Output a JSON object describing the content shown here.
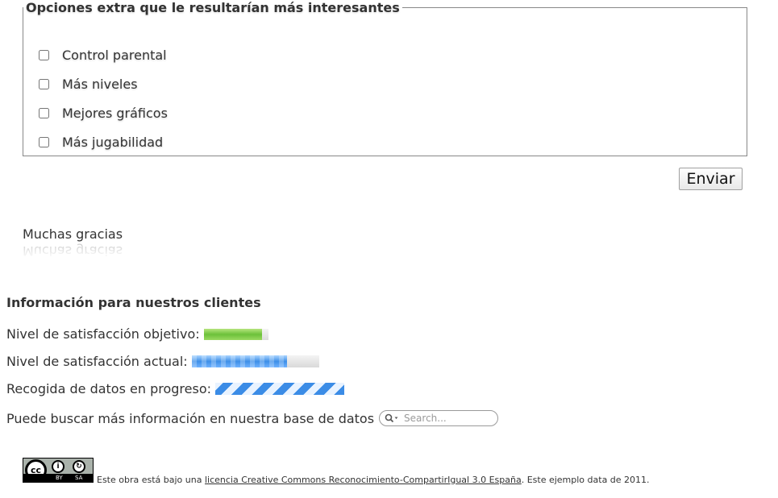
{
  "extras": {
    "legend": "Opciones extra que le resultarían más interesantes",
    "options": [
      {
        "label": "Control parental",
        "checked": false
      },
      {
        "label": "Más niveles",
        "checked": false
      },
      {
        "label": "Mejores gráficos",
        "checked": false
      },
      {
        "label": "Más jugabilidad",
        "checked": false
      }
    ]
  },
  "submit_label": "Enviar",
  "thanks": "Muchas gracias",
  "info": {
    "heading": "Información para nuestros clientes",
    "target_label": "Nivel de satisfacción objetivo:",
    "target_level": 0.9,
    "current_label": "Nivel de satisfacción actual:",
    "current_level": 0.75,
    "collecting_label": "Recogida de datos en progreso:",
    "search_label": "Puede buscar más información en nuestra base de datos",
    "search_placeholder": "Search..."
  },
  "colors": {
    "meter_green": "#6cc13a",
    "progress_blue": "#3d8fe8"
  },
  "footer": {
    "badge_cc": "cc",
    "badge_by": "BY",
    "badge_sa": "SA",
    "text_before": "Este obra está bajo una",
    "link_text": "licencia Creative Commons Reconocimiento-CompartirIgual 3.0 España",
    "text_after": ". Este ejemplo data de 2011."
  }
}
